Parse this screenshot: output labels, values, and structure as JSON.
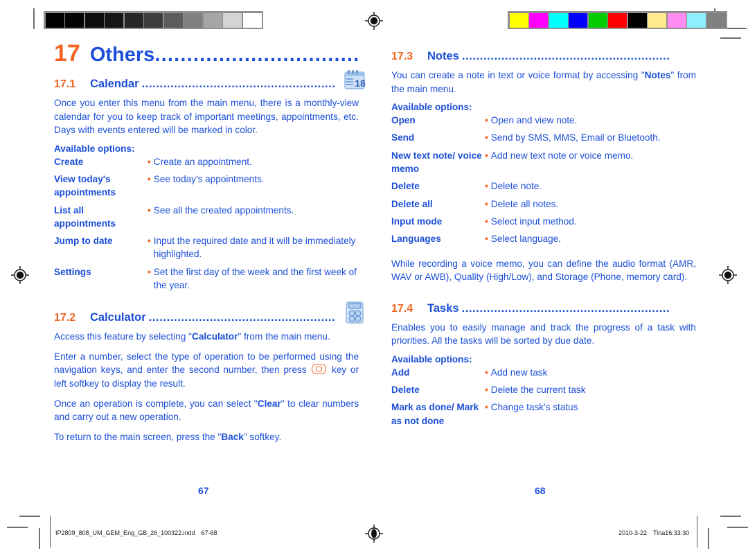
{
  "print_marks": {
    "gray_bar": {
      "name": "grayscale-calibration-bar",
      "swatches": [
        "#000000",
        "#040404",
        "#0d0d0d",
        "#161616",
        "#262626",
        "#3d3d3d",
        "#5c5c5c",
        "#808080",
        "#a6a6a6",
        "#d4d4d4",
        "#ffffff"
      ]
    },
    "color_bar": {
      "name": "color-calibration-bar",
      "swatches": [
        "#ffff00",
        "#ff00ff",
        "#00ffff",
        "#0000ff",
        "#00cc00",
        "#ff0000",
        "#000000",
        "#ffeb8c",
        "#ff8cf0",
        "#8cf0ff",
        "#808080"
      ]
    },
    "registration_marks": 4
  },
  "left_page": {
    "chapter": {
      "number": "17",
      "title": "Others",
      "dots": "......................................"
    },
    "sections": [
      {
        "number": "17.1",
        "title": "Calendar",
        "dots": ".......................................................",
        "icon": "calendar-icon",
        "paragraphs": [
          "Once you enter this menu from the main menu, there is a monthly-view calendar for you to keep track of important meetings, appointments, etc. Days with events entered will be marked in color."
        ],
        "available_options_label": "Available options:",
        "options": [
          {
            "name": "Create",
            "desc": "Create an appointment."
          },
          {
            "name": "View today's appointments",
            "desc": "See today's appointments."
          },
          {
            "name": "List all appointments",
            "desc": "See all the created appointments."
          },
          {
            "name": "Jump to date",
            "desc": "Input the required date and it will be immediately highlighted."
          },
          {
            "name": "Settings",
            "desc": "Set the first day of the week and the first week of the year."
          }
        ]
      },
      {
        "number": "17.2",
        "title": "Calculator",
        "dots": "....................................................",
        "icon": "calculator-icon",
        "paragraphs": [
          "Access this feature by selecting \"Calculator\" from the main menu.",
          "Once an operation is complete, you can select \"Clear\" to clear numbers and carry out a new operation.",
          "To return to the main screen, press the \"Back\" softkey."
        ],
        "key_paragraph": {
          "before": "Enter a number, select the type of operation to be performed using the navigation keys, and enter the second number, then press",
          "key_icon": "ok-key-icon",
          "after": "key or left softkey to display the result."
        },
        "bold_terms": [
          "Calculator",
          "Clear",
          "Back"
        ]
      }
    ],
    "page_number": "67"
  },
  "right_page": {
    "sections": [
      {
        "number": "17.3",
        "title": "Notes",
        "dots": "..........................................................",
        "paragraphs": [
          "You can create a note in text or voice format by accessing \"Notes\" from the main menu."
        ],
        "bold_terms": [
          "Notes"
        ],
        "available_options_label": "Available options:",
        "options": [
          {
            "name": "Open",
            "desc": "Open and view note."
          },
          {
            "name": "Send",
            "desc": "Send by SMS, MMS, Email or Bluetooth."
          },
          {
            "name": "New text note/ voice memo",
            "desc": "Add new text note or voice memo."
          },
          {
            "name": "Delete",
            "desc": "Delete note."
          },
          {
            "name": "Delete all",
            "desc": "Delete all notes."
          },
          {
            "name": "Input mode",
            "desc": "Select input method."
          },
          {
            "name": "Languages",
            "desc": "Select language."
          }
        ],
        "trailing_paragraph": "While recording a voice memo, you can define the audio format (AMR, WAV or AWB), Quality (High/Low), and Storage (Phone, memory card)."
      },
      {
        "number": "17.4",
        "title": "Tasks",
        "dots": "..........................................................",
        "paragraphs": [
          "Enables you to easily manage and track the progress of a task with priorities. All the tasks will be sorted by due date."
        ],
        "available_options_label": "Available options:",
        "options": [
          {
            "name": "Add",
            "desc": "Add new task"
          },
          {
            "name": "Delete",
            "desc": "Delete the current task"
          },
          {
            "name": "Mark as done/ Mark as not done",
            "desc": "Change task's status"
          }
        ]
      }
    ],
    "page_number": "68"
  },
  "footer": {
    "file_slug": "IP2809_808_UM_GEM_Eng_GB_26_100322.indd",
    "page_range": "67-68",
    "date": "2010-3-22",
    "operator_time": "Tina16:33:30"
  },
  "colors": {
    "heading_blue": "#1c4fd8",
    "accent_orange": "#f26522",
    "body_blue": "#1c4fd8"
  }
}
